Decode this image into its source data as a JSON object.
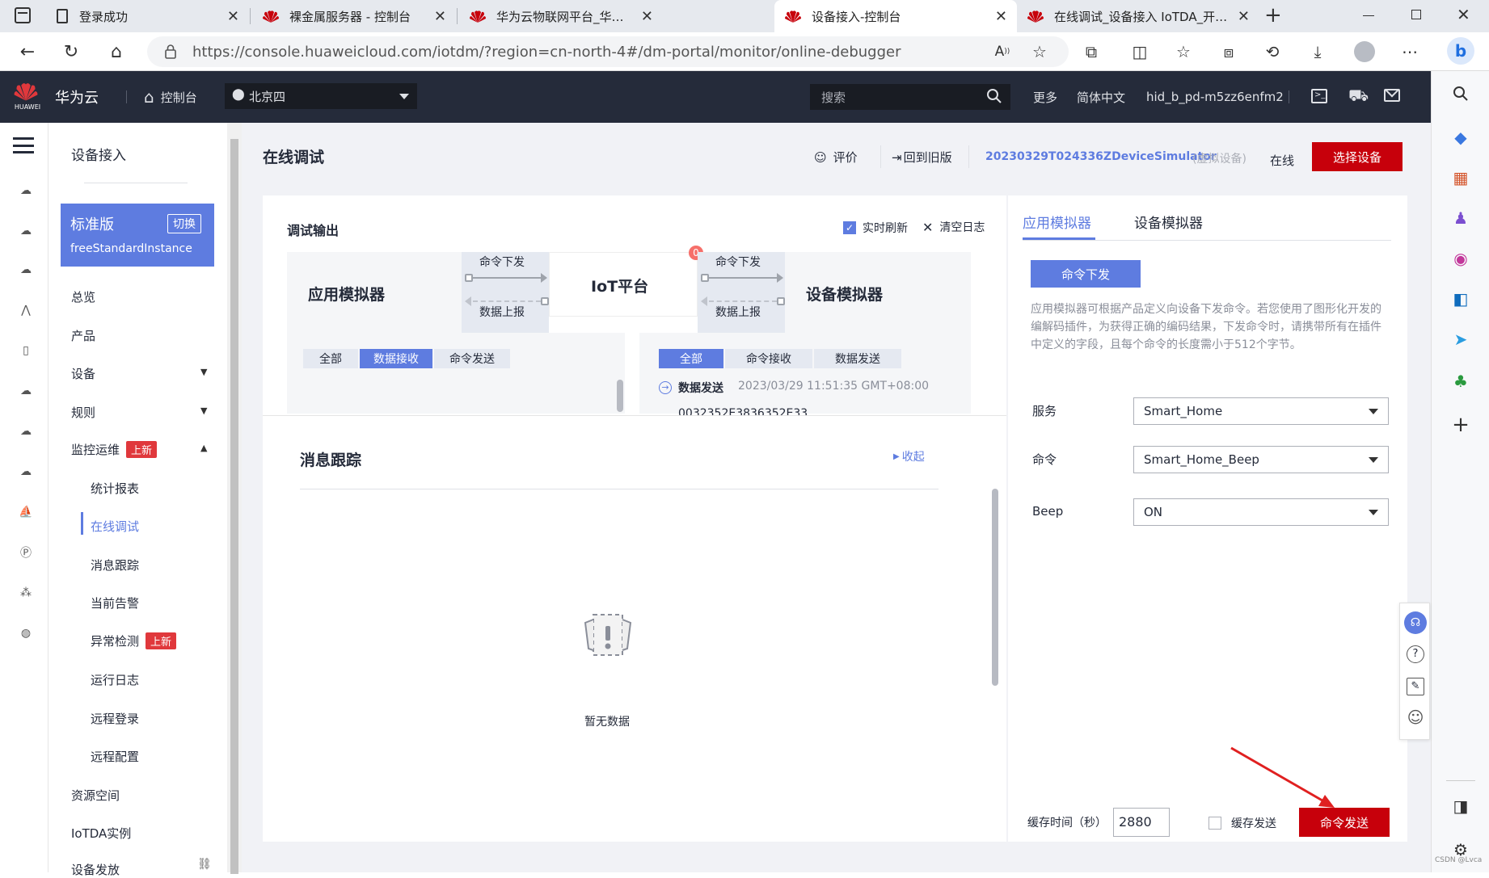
{
  "browser": {
    "tabs": [
      {
        "label": "登录成功",
        "active": false
      },
      {
        "label": "裸金属服务器 - 控制台",
        "active": false
      },
      {
        "label": "华为云物联网平台_华为云IoT平台",
        "active": false
      },
      {
        "label": "设备接入-控制台",
        "active": true
      },
      {
        "label": "在线调试_设备接入 IoTDA_开发指",
        "active": false
      }
    ],
    "url": "https://console.huaweicloud.com/iotdm/?region=cn-north-4#/dm-portal/monitor/online-debugger"
  },
  "header": {
    "brand_small": "HUAWEI",
    "brand": "华为云",
    "console": "控制台",
    "region": "北京四",
    "search_placeholder": "搜索",
    "more": "更多",
    "language": "简体中文",
    "username": "hid_b_pd-m5zz6enfm2"
  },
  "sidebar": {
    "title": "设备接入",
    "edition": "标准版",
    "switch": "切换",
    "instance": "freeStandardInstance",
    "items": [
      {
        "label": "总览"
      },
      {
        "label": "产品"
      },
      {
        "label": "设备"
      },
      {
        "label": "规则"
      },
      {
        "label": "监控运维",
        "badge": "上新"
      },
      {
        "label": "统计报表"
      },
      {
        "label": "在线调试"
      },
      {
        "label": "消息跟踪"
      },
      {
        "label": "当前告警"
      },
      {
        "label": "异常检测",
        "badge": "上新"
      },
      {
        "label": "运行日志"
      },
      {
        "label": "远程登录"
      },
      {
        "label": "远程配置"
      },
      {
        "label": "资源空间"
      },
      {
        "label": "IoTDA实例"
      },
      {
        "label": "设备发放"
      }
    ]
  },
  "page": {
    "title": "在线调试",
    "rate": "评价",
    "back_old": "回到旧版",
    "device_name": "20230329T024336ZDeviceSimulator",
    "device_type": "(虚拟设备)",
    "status": "在线",
    "select_device": "选择设备"
  },
  "debug": {
    "title": "调试输出",
    "realtime_refresh": "实时刷新",
    "realtime_checked": true,
    "clear_log": "清空日志",
    "app_sim": "应用模拟器",
    "iot_platform": "IoT平台",
    "device_sim": "设备模拟器",
    "cmd_down": "命令下发",
    "data_up": "数据上报",
    "badge_count": "0",
    "app_tabs": [
      "全部",
      "数据接收",
      "命令发送"
    ],
    "app_tab_active": 1,
    "dev_tabs": [
      "全部",
      "命令接收",
      "数据发送"
    ],
    "dev_tab_active": 0,
    "log_type": "数据发送",
    "log_time": "2023/03/29 11:51:35 GMT+08:00",
    "log_payload": "0032352E3836352E33"
  },
  "trace": {
    "title": "消息跟踪",
    "collapse": "收起",
    "empty": "暂无数据"
  },
  "simulator": {
    "tabs": [
      "应用模拟器",
      "设备模拟器"
    ],
    "active_tab": 0,
    "cmd_button": "命令下发",
    "description": "应用模拟器可根据产品定义向设备下发命令。若您使用了图形化开发的编解码插件，为获得正确的编码结果，下发命令时，请携带所有在插件中定义的字段，且每个命令的长度需小于512个字节。",
    "service_label": "服务",
    "service_value": "Smart_Home",
    "command_label": "命令",
    "command_value": "Smart_Home_Beep",
    "beep_label": "Beep",
    "beep_value": "ON",
    "cache_time_label": "缓存时间（秒）",
    "cache_time_value": "2880",
    "cache_send": "缓存发送",
    "cache_send_checked": false,
    "send_button": "命令发送"
  },
  "watermark": "CSDN @Lvca",
  "colors": {
    "accent": "#5e7ce0",
    "brand_red": "#c7000b",
    "header_bg": "#252b3a"
  }
}
